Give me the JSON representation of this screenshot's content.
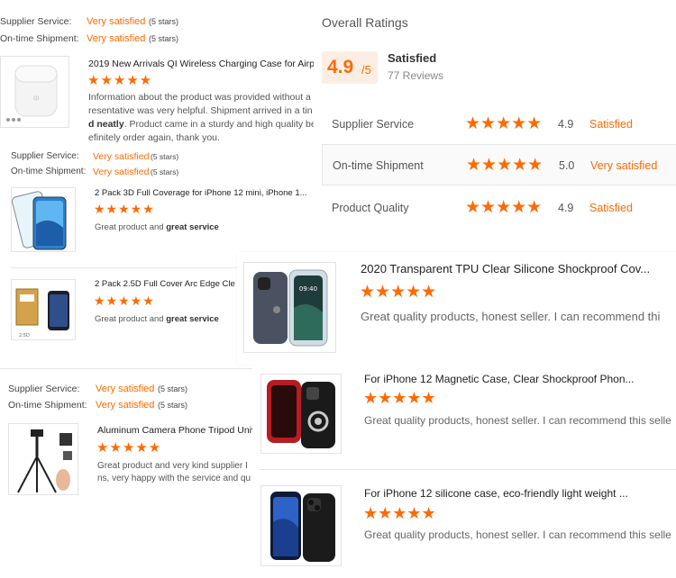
{
  "left_top": {
    "supplier_label": "Supplier Service:",
    "supplier_value": "Very satisfied",
    "supplier_stars": "(5 stars)",
    "shipment_label": "On-time Shipment:",
    "shipment_value": "Very satisfied",
    "shipment_stars": "(5 stars)"
  },
  "review1": {
    "title": "2019 New Arrivals QI Wireless Charging Case for Airp",
    "stars": "★★★★★",
    "text_line1": "Information about the product was provided without a",
    "text_line2": "resentative was very helpful.  Shipment arrived in a tin",
    "text_line3_bold": "d neatly",
    "text_line3_rest": ".  Product came in a sturdy and high quality be",
    "text_line4": "efinitely order again, thank you.",
    "supplier_label": "Supplier Service:",
    "supplier_value": "Very satisfied",
    "supplier_stars": "(5 stars)",
    "shipment_label": "On-time Shipment:",
    "shipment_value": "Very satisfied",
    "shipment_stars": "(5 stars)"
  },
  "review2": {
    "title": "2 Pack 3D Full Coverage for iPhone 12 mini, iPhone 1...",
    "stars": "★★★★★",
    "text_plain": "Great product and ",
    "text_bold": "great service"
  },
  "review3": {
    "title": "2 Pack 2.5D Full Cover Arc Edge Cle",
    "stars": "★★★★★",
    "text_plain": "Great product and ",
    "text_bold": "great service"
  },
  "left_bottom": {
    "supplier_label": "Supplier Service:",
    "supplier_value": "Very satisfied",
    "supplier_stars": "(5 stars)",
    "shipment_label": "On-time Shipment:",
    "shipment_value": "Very satisfied",
    "shipment_stars": "(5 stars)"
  },
  "review4": {
    "title": "Aluminum Camera Phone Tripod Univ",
    "stars": "★★★★★",
    "text_line1": "Great product and very kind supplier I",
    "text_line2": "ns, very happy with the service and qu"
  },
  "overall": {
    "heading": "Overall Ratings",
    "score": "4.9",
    "score_suffix": "/5",
    "status": "Satisfied",
    "reviews": "77 Reviews",
    "rows": [
      {
        "label": "Supplier Service",
        "stars": "★★★★★",
        "score": "4.9",
        "status": "Satisfied"
      },
      {
        "label": "On-time Shipment",
        "stars": "★★★★★",
        "score": "5.0",
        "status": "Very satisfied"
      },
      {
        "label": "Product Quality",
        "stars": "★★★★★",
        "score": "4.9",
        "status": "Satisfied"
      }
    ]
  },
  "review5": {
    "title": "2020 Transparent TPU Clear Silicone Shockproof Cov...",
    "stars": "★★★★★",
    "text": "Great quality products, honest seller. I can recommend thi",
    "phone_time": "09:40"
  },
  "review6": {
    "title": "For iPhone 12 Magnetic Case, Clear Shockproof Phon...",
    "stars": "★★★★★",
    "text": "Great quality products, honest seller. I can recommend this selle"
  },
  "review7": {
    "title": "For iPhone 12 silicone case, eco-friendly light weight ...",
    "stars": "★★★★★",
    "text": "Great quality products, honest seller. I can recommend this selle"
  },
  "colors": {
    "accent": "#ff6a00",
    "score_bg": "#fdeee3",
    "divider": "#e6e6e6"
  }
}
